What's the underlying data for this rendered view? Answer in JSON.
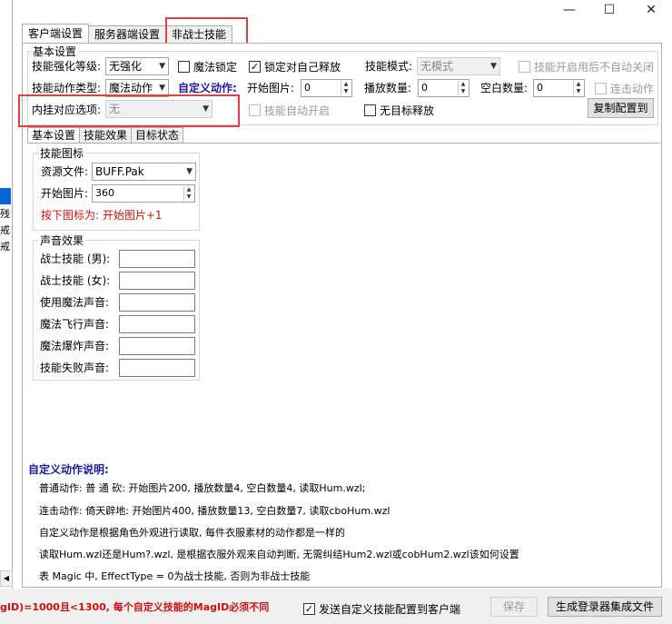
{
  "window": {
    "controls": {
      "minimize": "—",
      "maximize": "☐",
      "close": "✕"
    }
  },
  "left_panel": {
    "chars": [
      "残",
      "戒",
      "戒"
    ]
  },
  "tabs": [
    {
      "label": "客户端设置"
    },
    {
      "label": "服务器端设置"
    },
    {
      "label": "非战士技能"
    }
  ],
  "basic_settings": {
    "title": "基本设置",
    "skill_strengthen_label": "技能强化等级:",
    "skill_strengthen_value": "无强化",
    "magic_lock_label": "魔法锁定",
    "lock_self_label": "锁定对自己释放",
    "skill_mode_label": "技能模式:",
    "skill_mode_value": "无模式",
    "no_auto_close_label": "技能开启用后不自动关闭",
    "action_type_label": "技能动作类型:",
    "action_type_value": "魔法动作",
    "custom_action_label": "自定义动作:",
    "start_image_label": "开始图片:",
    "start_image_value": "0",
    "play_count_label": "播放数量:",
    "play_count_value": "0",
    "blank_count_label": "空白数量:",
    "blank_count_value": "0",
    "combo_action_label": "连击动作",
    "plugin_label": "内挂对应选项:",
    "plugin_value": "无",
    "auto_start_label": "技能自动开启",
    "no_target_label": "无目标释放",
    "copy_config_button": "复制配置到"
  },
  "sub_tabs": [
    {
      "label": "基本设置"
    },
    {
      "label": "技能效果"
    },
    {
      "label": "目标状态"
    }
  ],
  "skill_icon": {
    "title": "技能图标",
    "resource_label": "资源文件:",
    "resource_value": "BUFF.Pak",
    "start_label": "开始图片:",
    "start_value": "360",
    "hint": "按下图标为: 开始图片+1"
  },
  "sound": {
    "title": "声音效果",
    "rows": [
      {
        "label": "战士技能 (男):"
      },
      {
        "label": "战士技能 (女):"
      },
      {
        "label": "使用魔法声音:"
      },
      {
        "label": "魔法飞行声音:"
      },
      {
        "label": "魔法爆炸声音:"
      },
      {
        "label": "技能失败声音:"
      }
    ]
  },
  "description": {
    "title": "自定义动作说明:",
    "lines": [
      "普通动作: 普 通 砍: 开始图片200, 播放数量4, 空白数量4, 读取Hum.wzl;",
      "连击动作: 倚天辟地: 开始图片400, 播放数量13, 空白数量7, 读取cboHum.wzl",
      "自定义动作是根据角色外观进行读取, 每件衣服素材的动作都是一样的",
      "读取Hum.wzl还是Hum?.wzl, 是根据衣服外观来自动判断, 无需纠结Hum2.wzl或cobHum2.wzl该如何设置",
      "表 Magic 中, EffectType = 0为战士技能, 否则为非战士技能"
    ]
  },
  "bottom": {
    "warning": "gID)=1000且<1300, 每个自定义技能的MagID必须不同",
    "send_config_label": "发送自定义技能配置到客户端",
    "save_button": "保存",
    "generate_button": "生成登录器集成文件"
  },
  "colors": {
    "accent_red": "#e04040",
    "link_blue": "#1a1aa6",
    "hint_red": "#d01010"
  }
}
